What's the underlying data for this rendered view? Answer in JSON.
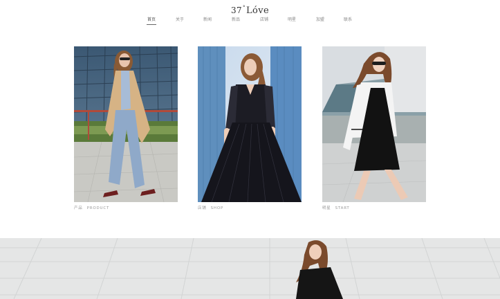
{
  "header": {
    "logo_number": "37",
    "logo_degree": "°",
    "logo_word": "Lóve"
  },
  "nav": {
    "items": [
      {
        "label": "首页",
        "active": true
      },
      {
        "label": "关于",
        "active": false
      },
      {
        "label": "新闻",
        "active": false
      },
      {
        "label": "新品",
        "active": false
      },
      {
        "label": "店铺",
        "active": false
      },
      {
        "label": "明星",
        "active": false
      },
      {
        "label": "加盟",
        "active": false
      },
      {
        "label": "联系",
        "active": false
      }
    ]
  },
  "cards": [
    {
      "caption_cn": "产品",
      "caption_en": "PRODUCT"
    },
    {
      "caption_cn": "店铺",
      "caption_en": "SHOP"
    },
    {
      "caption_cn": "明星",
      "caption_en": "START"
    }
  ],
  "colors": {
    "background": "#ffffff",
    "text": "#333333",
    "muted": "#8a8a8a"
  }
}
